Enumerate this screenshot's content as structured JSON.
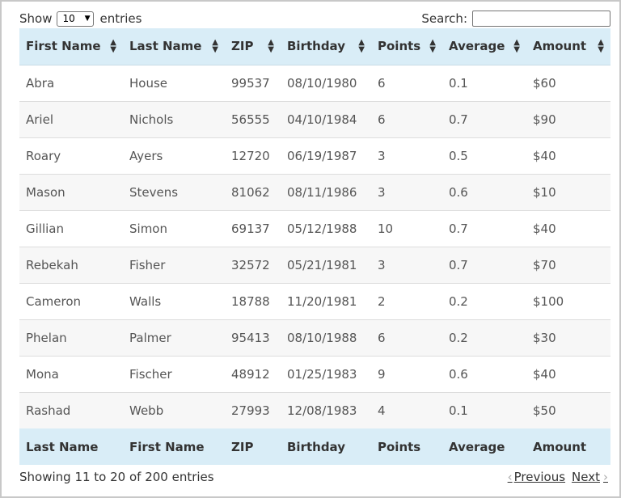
{
  "length": {
    "show_label": "Show",
    "selected": "10",
    "entries_label": "entries"
  },
  "search": {
    "label": "Search:",
    "value": ""
  },
  "header": [
    "First Name",
    "Last Name",
    "ZIP",
    "Birthday",
    "Points",
    "Average",
    "Amount"
  ],
  "rows": [
    [
      "Abra",
      "House",
      "99537",
      "08/10/1980",
      "6",
      "0.1",
      "$60"
    ],
    [
      "Ariel",
      "Nichols",
      "56555",
      "04/10/1984",
      "6",
      "0.7",
      "$90"
    ],
    [
      "Roary",
      "Ayers",
      "12720",
      "06/19/1987",
      "3",
      "0.5",
      "$40"
    ],
    [
      "Mason",
      "Stevens",
      "81062",
      "08/11/1986",
      "3",
      "0.6",
      "$10"
    ],
    [
      "Gillian",
      "Simon",
      "69137",
      "05/12/1988",
      "10",
      "0.7",
      "$40"
    ],
    [
      "Rebekah",
      "Fisher",
      "32572",
      "05/21/1981",
      "3",
      "0.7",
      "$70"
    ],
    [
      "Cameron",
      "Walls",
      "18788",
      "11/20/1981",
      "2",
      "0.2",
      "$100"
    ],
    [
      "Phelan",
      "Palmer",
      "95413",
      "08/10/1988",
      "6",
      "0.2",
      "$30"
    ],
    [
      "Mona",
      "Fischer",
      "48912",
      "01/25/1983",
      "9",
      "0.6",
      "$40"
    ],
    [
      "Rashad",
      "Webb",
      "27993",
      "12/08/1983",
      "4",
      "0.1",
      "$50"
    ]
  ],
  "footer": [
    "Last Name",
    "First Name",
    "ZIP",
    "Birthday",
    "Points",
    "Average",
    "Amount"
  ],
  "info": "Showing 11 to 20 of 200 entries",
  "pagination": {
    "previous": "Previous",
    "next": "Next"
  },
  "icons": {
    "sort": "sort-both-icon",
    "prev": "chevron-left-icon",
    "next": "chevron-right-icon"
  }
}
